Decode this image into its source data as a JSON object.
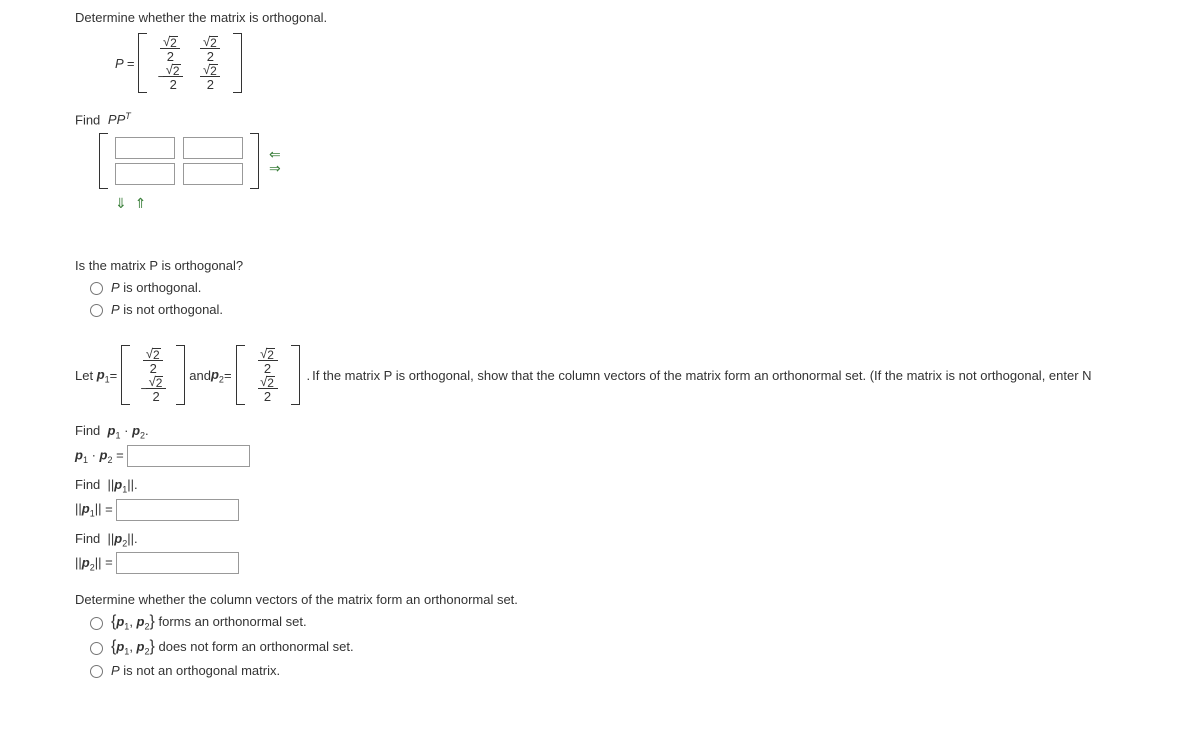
{
  "q1": {
    "prompt": "Determine whether the matrix is orthogonal.",
    "lhs": "P =",
    "m2": "2",
    "findPPT_label": "Find",
    "findPPT_var": "PP",
    "findPPT_sup": "T"
  },
  "ortho_q": {
    "heading": "Is the matrix P is orthogonal?",
    "opt1": "P is orthogonal.",
    "opt2": "P is not orthogonal."
  },
  "vectors": {
    "let": "Let",
    "p1": "p",
    "sub1": "1",
    "eq": " = ",
    "and": " and ",
    "p2": "p",
    "sub2": "2",
    "period": ".",
    "tail": " If the matrix P is orthogonal, show that the column vectors of the matrix form an orthonormal set. (If the matrix is not orthogonal, enter N",
    "m2": "2"
  },
  "dot": {
    "find": "Find",
    "expr": "p",
    "sub1": "1",
    "mid": " · ",
    "sub2": "2",
    "period": ".",
    "label": "p",
    "eq": " = "
  },
  "norm1": {
    "find": "Find",
    "label": "p",
    "sub": "1",
    "period": ".",
    "eq": " = "
  },
  "norm2": {
    "find": "Find",
    "label": "p",
    "sub": "2",
    "period": ".",
    "eq": " = "
  },
  "final": {
    "heading": "Determine whether the column vectors of the matrix form an orthonormal set.",
    "opt1_tail": " forms an orthonormal set.",
    "opt2_tail": " does not form an orthonormal set.",
    "opt3": "P is not an orthogonal matrix.",
    "p1": "p",
    "sub1": "1",
    "comma": ", ",
    "p2": "p",
    "sub2": "2"
  },
  "arrows": {
    "left": "⇐",
    "right": "⇒",
    "down": "⇓",
    "up": "⇑"
  }
}
